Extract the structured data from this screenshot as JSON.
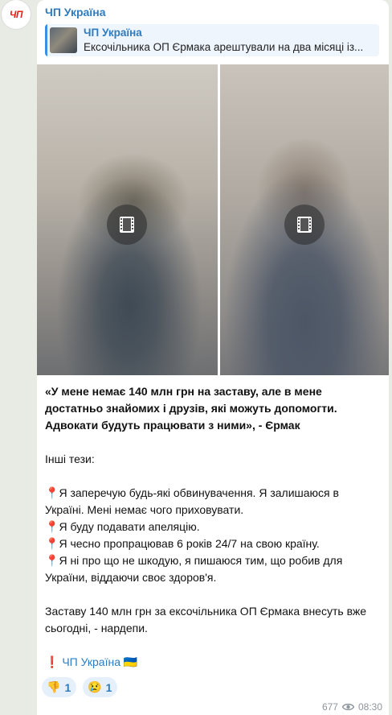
{
  "avatar": {
    "text": "ЧП"
  },
  "post": {
    "channel_name": "ЧП Україна",
    "reply": {
      "title": "ЧП Україна",
      "text": "Ексочільника ОП Єрмака арештували на два місяці із..."
    },
    "media": [
      {
        "type": "video",
        "icon": "film-icon"
      },
      {
        "type": "video",
        "icon": "film-icon"
      }
    ],
    "body": {
      "quote": "«У мене немає 140 млн грн на заставу, але в мене достатньо знайомих і друзів, які можуть допомогти. Адвокати будуть працювати з ними», - Єрмак",
      "subheading": "Інші тези:",
      "bullets": [
        "Я заперечую будь-які обвинувачення. Я залишаюся в Україні. Мені немає чого приховувати.",
        "Я буду подавати апеляцію.",
        "Я чесно пропрацював 6 років 24/7 на свою країну.",
        "Я ні про що не шкодую, я пишаюся тим, що робив для України, віддаючи своє здоров'я."
      ],
      "bullet_icon": "📍",
      "closing": "Заставу 140 млн грн за ексочільника ОП Єрмака внесуть вже сьогодні, - нардепи.",
      "signature_mark": "❗",
      "signature": "ЧП Україна",
      "signature_flag": "🇺🇦"
    },
    "reactions": [
      {
        "emoji": "👎",
        "count": "1"
      },
      {
        "emoji": "😢",
        "count": "1"
      }
    ],
    "views": "677",
    "time": "08:30"
  },
  "colors": {
    "accent": "#2f7bbf",
    "reply_bg": "#eef5fc",
    "chat_bg": "#e7ebe4"
  }
}
